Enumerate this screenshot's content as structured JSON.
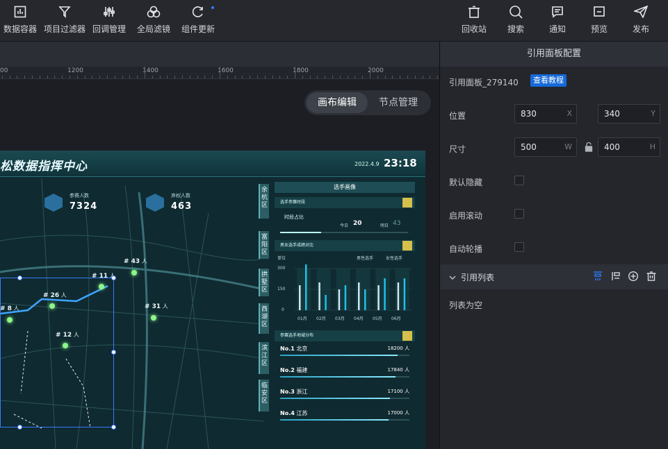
{
  "toolbar": {
    "left": [
      {
        "label": "数据容器",
        "icon": "chart-box-icon"
      },
      {
        "label": "项目过滤器",
        "icon": "filter-icon"
      },
      {
        "label": "回调管理",
        "icon": "sliders-icon"
      },
      {
        "label": "全局滤镜",
        "icon": "circles-icon"
      },
      {
        "label": "组件更新",
        "icon": "refresh-icon"
      }
    ],
    "right": [
      {
        "label": "回收站",
        "icon": "trash-icon"
      },
      {
        "label": "搜索",
        "icon": "search-icon"
      },
      {
        "label": "通知",
        "icon": "message-icon"
      },
      {
        "label": "预览",
        "icon": "preview-icon"
      },
      {
        "label": "发布",
        "icon": "send-icon"
      }
    ]
  },
  "ruler": {
    "labels": [
      "00",
      "1200",
      "1400",
      "1600",
      "1800",
      "2000"
    ]
  },
  "canvas_tabs": {
    "edit": "画布编辑",
    "nodes": "节点管理",
    "active": "画布编辑"
  },
  "screen": {
    "title": "松数据指挥中心",
    "date": "2022.4.9",
    "time": "23:18",
    "kpis": [
      {
        "label": "参赛人数",
        "value": "7324"
      },
      {
        "label": "弃权人数",
        "value": "463"
      }
    ],
    "map_labels": [
      {
        "num": "# 43",
        "unit": "人"
      },
      {
        "num": "# 11",
        "unit": "人"
      },
      {
        "num": "# 26",
        "unit": "人"
      },
      {
        "num": "# 31",
        "unit": "人"
      },
      {
        "num": "# 8",
        "unit": "人"
      },
      {
        "num": "# 12",
        "unit": "人"
      }
    ],
    "districts": [
      "余杭区",
      "富阳区",
      "拱墅区",
      "西湖区",
      "滨江区",
      "临安区"
    ],
    "side": {
      "title": "选手画像",
      "block1": {
        "title": "选手参赛时段",
        "sub": "时段占比",
        "today_label": "今日",
        "today": "20",
        "tomorrow_label": "明日",
        "tomorrow": "43"
      },
      "block2": {
        "title": "男女选手成绩对比",
        "unit": "单位",
        "legend": [
          "男性选手",
          "女性选手"
        ],
        "yticks": [
          "300",
          "150",
          "0"
        ],
        "months": [
          "01月",
          "02月",
          "03月",
          "04月",
          "05月",
          "06月"
        ]
      },
      "block3": {
        "title": "参赛选手地域分布",
        "ranks": [
          {
            "no": "No.1",
            "city": "北京",
            "value": "18200",
            "unit": "人",
            "pct": 0.91
          },
          {
            "no": "No.2",
            "city": "福建",
            "value": "17840",
            "unit": "人",
            "pct": 0.89
          },
          {
            "no": "No.3",
            "city": "浙江",
            "value": "17100",
            "unit": "人",
            "pct": 0.85
          },
          {
            "no": "No.4",
            "city": "江苏",
            "value": "17000",
            "unit": "人",
            "pct": 0.84
          }
        ]
      }
    }
  },
  "chart_data": {
    "type": "bar",
    "categories": [
      "01月",
      "02月",
      "03月",
      "04月",
      "05月",
      "06月"
    ],
    "series": [
      {
        "name": "男性选手",
        "values": [
          180,
          200,
          150,
          200,
          180,
          200
        ]
      },
      {
        "name": "女性选手",
        "values": [
          330,
          110,
          180,
          150,
          230,
          230
        ]
      }
    ],
    "ylim": [
      0,
      300
    ]
  },
  "panel": {
    "title": "引用面板配置",
    "name": "引用面板_279140",
    "tutorial": "查看教程",
    "position_label": "位置",
    "x": "830",
    "x_unit": "X",
    "y": "340",
    "y_unit": "Y",
    "size_label": "尺寸",
    "w": "500",
    "w_unit": "W",
    "h": "400",
    "h_unit": "H",
    "hidden_label": "默认隐藏",
    "scroll_label": "启用滚动",
    "carousel_label": "自动轮播",
    "list_title": "引用列表",
    "empty": "列表为空"
  }
}
